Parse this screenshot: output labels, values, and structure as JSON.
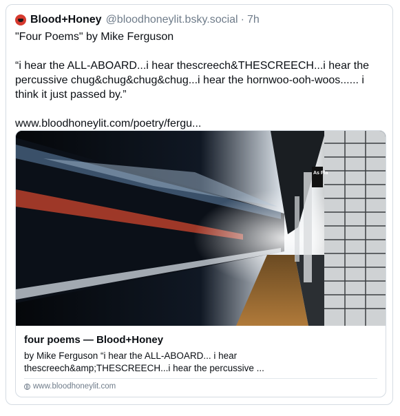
{
  "post": {
    "display_name": "Blood+Honey",
    "handle": "@bloodhoneylit.bsky.social",
    "separator": "·",
    "time": "7h",
    "title_line": "\"Four Poems\" by Mike Ferguson",
    "quote_line_1": "“i hear the ALL-ABOARD...i hear thescreech&THESCREECH...i hear the",
    "quote_line_2": "percussive chug&chug&chug&chug...i hear the hornwoo-ooh-woos...... i",
    "quote_line_3": "think it just passed by.”",
    "link_text": "www.bloodhoneylit.com/poetry/fergu..."
  },
  "card": {
    "title": "four poems — Blood+Honey",
    "desc_line_1": "by Mike Ferguson   “i hear the  ALL-ABOARD... i hear",
    "desc_line_2": "thescreech&amp;THESCREECH...i hear the percussive ...",
    "domain": "www.bloodhoneylit.com",
    "image_sign_text": "As Pla"
  },
  "icons": {
    "avatar": "blood-honey-logo",
    "domain": "globe-icon"
  },
  "colors": {
    "name": "#0b0f14",
    "muted": "#6f7c8a",
    "border": "#d4dbe2",
    "avatar": "#d63a2f"
  }
}
